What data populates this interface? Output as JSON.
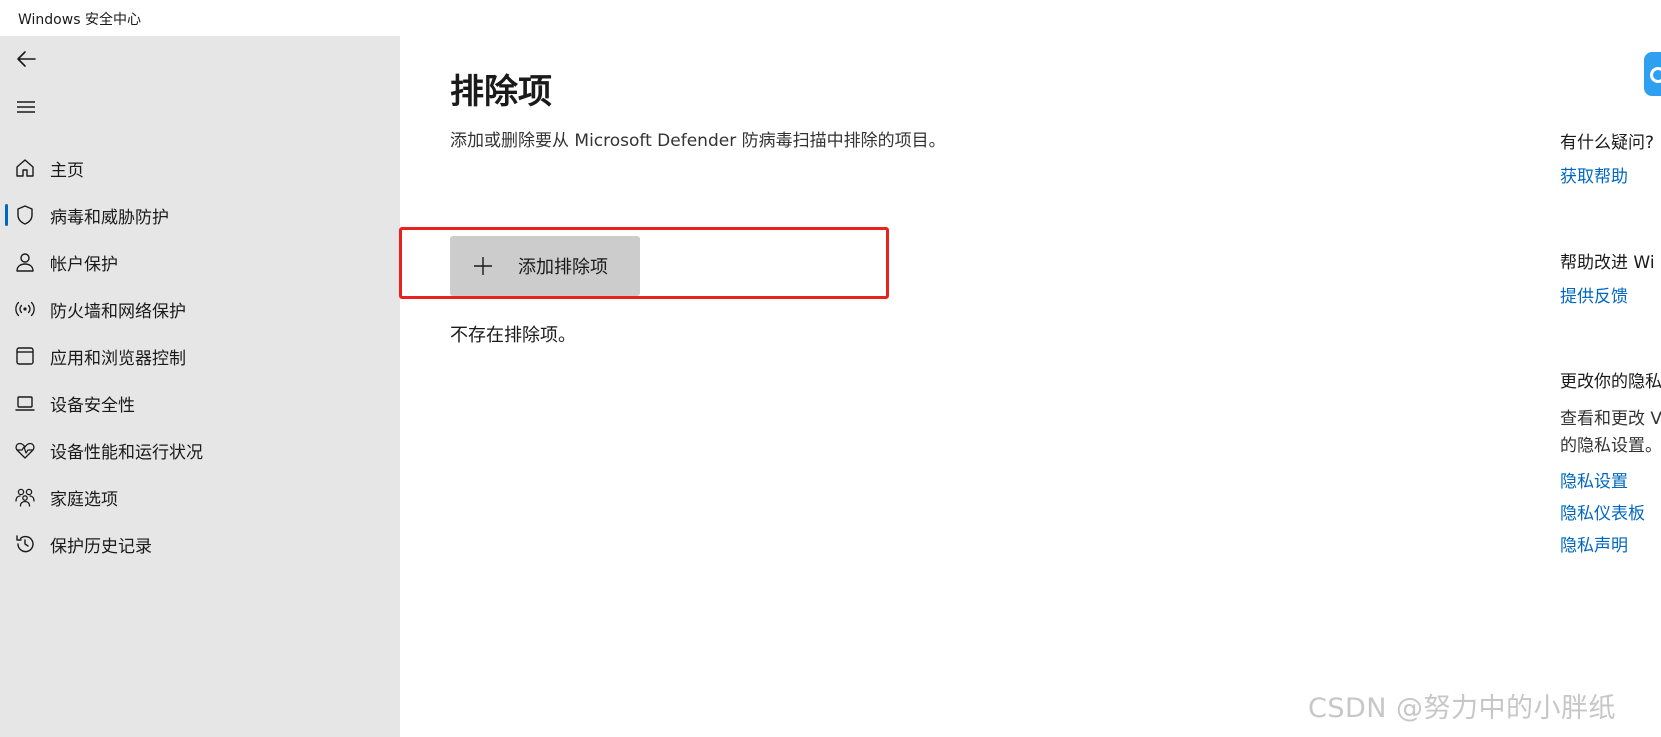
{
  "window": {
    "title": "Windows 安全中心"
  },
  "sidebar": {
    "back_icon": "back-arrow-icon",
    "menu_icon": "hamburger-menu-icon",
    "items": [
      {
        "label": "主页",
        "icon": "home-icon",
        "active": false
      },
      {
        "label": "病毒和威胁防护",
        "icon": "shield-icon",
        "active": true
      },
      {
        "label": "帐户保护",
        "icon": "person-icon",
        "active": false
      },
      {
        "label": "防火墙和网络保护",
        "icon": "wifi-antenna-icon",
        "active": false
      },
      {
        "label": "应用和浏览器控制",
        "icon": "app-window-icon",
        "active": false
      },
      {
        "label": "设备安全性",
        "icon": "laptop-icon",
        "active": false
      },
      {
        "label": "设备性能和运行状况",
        "icon": "heart-pulse-icon",
        "active": false
      },
      {
        "label": "家庭选项",
        "icon": "family-icon",
        "active": false
      },
      {
        "label": "保护历史记录",
        "icon": "history-icon",
        "active": false
      }
    ]
  },
  "main": {
    "title": "排除项",
    "description": "添加或删除要从 Microsoft Defender 防病毒扫描中排除的项目。",
    "add_button_label": "添加排除项",
    "empty_message": "不存在排除项。"
  },
  "rightpanel": {
    "question_heading": "有什么疑问?",
    "get_help_link": "获取帮助",
    "improve_heading": "帮助改进 Wi",
    "feedback_link": "提供反馈",
    "privacy_heading": "更改你的隐私",
    "privacy_text_1": "查看和更改 V",
    "privacy_text_2": "的隐私设置。",
    "privacy_settings_link": "隐私设置",
    "privacy_dashboard_link": "隐私仪表板",
    "privacy_statement_link": "隐私声明"
  },
  "watermark": "CSDN @努力中的小胖纸",
  "colors": {
    "accent": "#0067c0",
    "highlight_border": "#e8231f",
    "sidebar_bg": "#e6e6e6",
    "button_bg": "#cccccc",
    "badge": "#2f9ff0"
  }
}
